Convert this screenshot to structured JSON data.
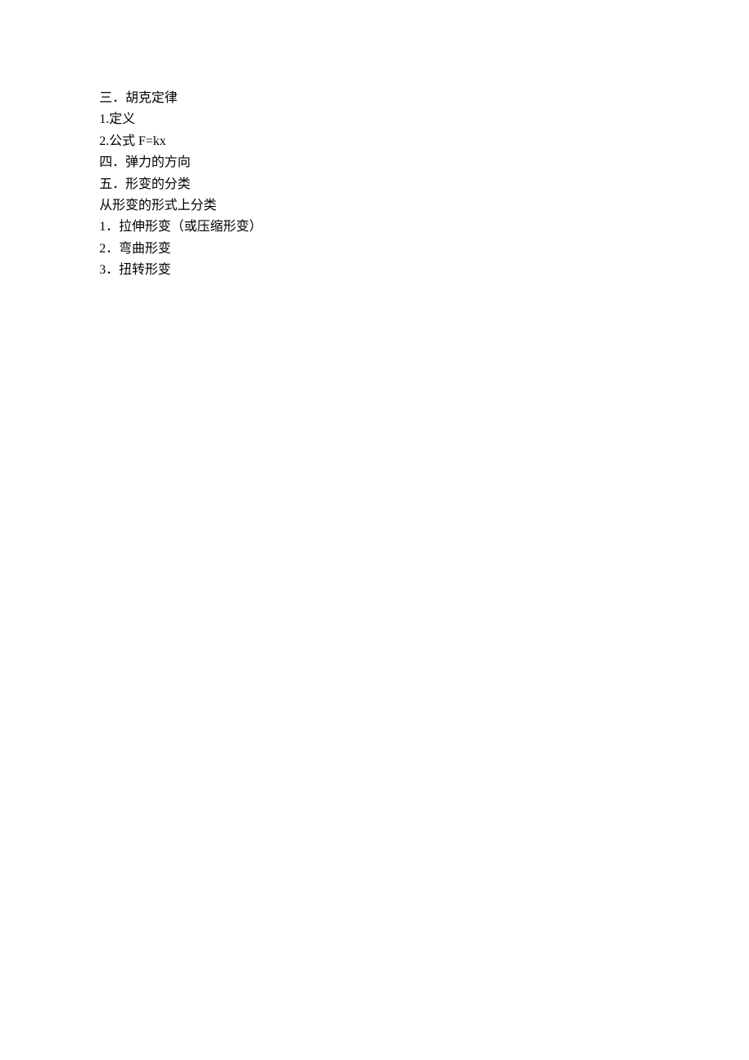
{
  "lines": [
    "三．胡克定律",
    "1.定义",
    "2.公式  F=kx",
    "四．弹力的方向",
    "五．形变的分类",
    "从形变的形式上分类",
    "1．拉伸形变（或压缩形变）",
    "2．弯曲形变",
    "3．扭转形变"
  ]
}
